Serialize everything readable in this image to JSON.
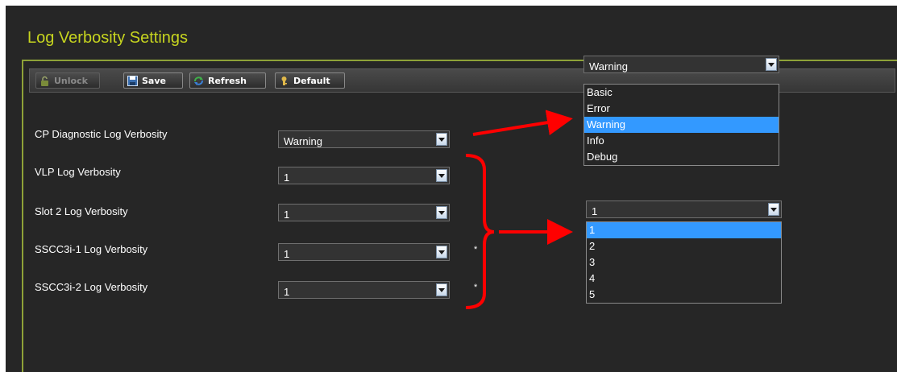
{
  "page": {
    "title": "Log Verbosity Settings"
  },
  "toolbar": {
    "unlock_label": "Unlock",
    "save_label": "Save",
    "refresh_label": "Refresh",
    "default_label": "Default"
  },
  "settings": [
    {
      "label": "CP Diagnostic Log Verbosity",
      "value": "Warning"
    },
    {
      "label": "VLP Log Verbosity",
      "value": "1"
    },
    {
      "label": "Slot 2 Log Verbosity",
      "value": "1"
    },
    {
      "label": "SSCC3i-1 Log Verbosity",
      "value": "1",
      "marker": "*"
    },
    {
      "label": "SSCC3i-2 Log Verbosity",
      "value": "1",
      "marker": "*"
    }
  ],
  "level_dropdown": {
    "value": "Warning",
    "options": [
      "Basic",
      "Error",
      "Warning",
      "Info",
      "Debug"
    ],
    "highlighted": "Warning"
  },
  "number_dropdown": {
    "value": "1",
    "options": [
      "1",
      "2",
      "3",
      "4",
      "5"
    ],
    "highlighted": "1"
  },
  "colors": {
    "title": "#c7d51f",
    "panel_border": "#8ea238",
    "background": "#262626",
    "highlight": "#3399ff",
    "annotation": "#ff0000"
  }
}
